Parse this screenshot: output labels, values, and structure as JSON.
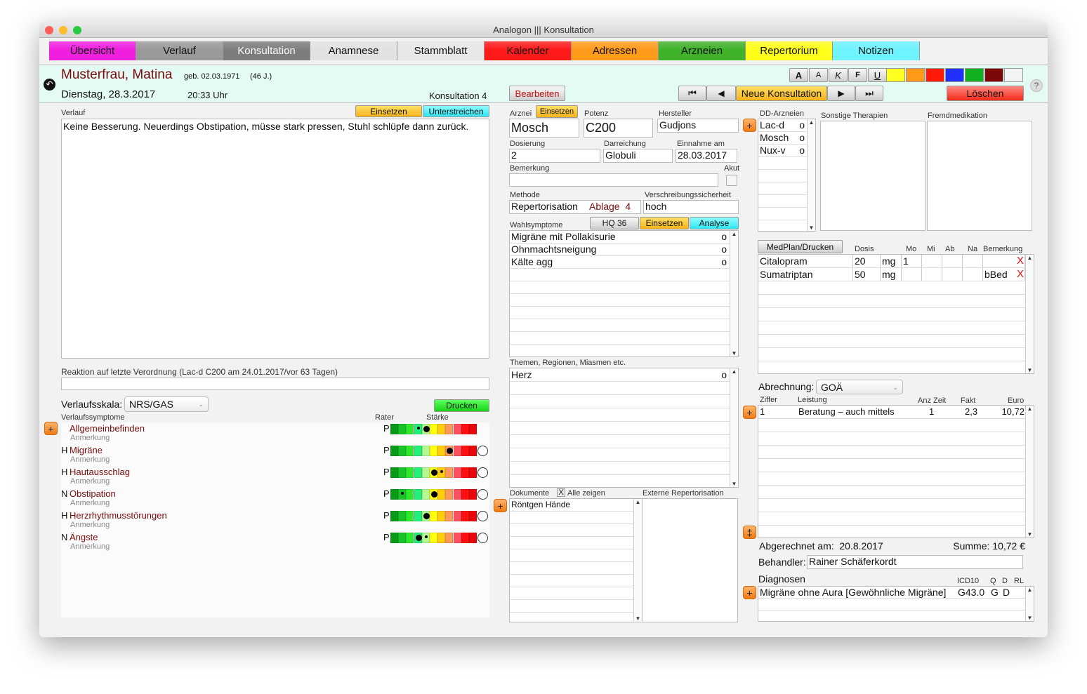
{
  "window": {
    "title": "Analogon ||| Konsultation"
  },
  "tabs": [
    {
      "label": "Übersicht",
      "color": "#f01fe0"
    },
    {
      "label": "Verlauf",
      "color": "#9a9a9a"
    },
    {
      "label": "Konsultation",
      "color": "#7d7d7d",
      "active": true
    },
    {
      "label": "Anamnese",
      "color": "#e2e2e2"
    },
    {
      "label": "Stammblatt",
      "color": "#e8e8e8"
    },
    {
      "label": "Kalender",
      "color": "#ff1a1a"
    },
    {
      "label": "Adressen",
      "color": "#ff9b1a"
    },
    {
      "label": "Arzneien",
      "color": "#3fb22a"
    },
    {
      "label": "Repertorium",
      "color": "#ffff1a"
    },
    {
      "label": "Notizen",
      "color": "#6ff3ff"
    }
  ],
  "header": {
    "patient_name": "Musterfrau, Matina",
    "birth": "geb. 02.03.1971",
    "age": "(46 J.)",
    "date": "Dienstag, 28.3.2017",
    "time": "20:33 Uhr",
    "consultation": "Konsultation 4",
    "edit": "Bearbeiten",
    "new_consultation": "Neue Konsultation",
    "delete": "Löschen",
    "help": "?",
    "format_buttons": [
      "A",
      "A",
      "K",
      "F",
      "U"
    ],
    "colors": [
      "#ffff22",
      "#ff9a1a",
      "#ff1a0a",
      "#2030ff",
      "#10b020",
      "#7a0808",
      "#f4f4f4"
    ]
  },
  "verlauf": {
    "label": "Verlauf",
    "insert": "Einsetzen",
    "underline": "Unterstreichen",
    "text": "Keine Besserung. Neuerdings Obstipation, müsse stark pressen, Stuhl schlüpfe dann zurück.",
    "reaction_label": "Reaktion auf letzte Verordnung  (Lac-d C200 am 24.01.2017/vor 63 Tagen)",
    "reaction_value": "",
    "scale_label": "Verlaufsskala:",
    "scale_value": "NRS/GAS",
    "print": "Drucken",
    "symptoms_label": "Verlaufssymptome",
    "rater_label": "Rater",
    "strength_label": "Stärke",
    "scale_colors": [
      "#0a9a1a",
      "#18c42a",
      "#2ee82e",
      "#22f07a",
      "#b6f790",
      "#ffff10",
      "#ffcc10",
      "#ff9a5a",
      "#ff5060",
      "#ff1010",
      "#e80808"
    ],
    "symptoms": [
      {
        "prefix": "",
        "name": "Allgemeinbefinden",
        "note": "Anmerkung",
        "rater": "P",
        "value": 4,
        "previous": 3,
        "circle": false
      },
      {
        "prefix": "H",
        "name": "Migräne",
        "note": "Anmerkung",
        "rater": "P",
        "value": 7,
        "previous": null,
        "circle": true
      },
      {
        "prefix": "H",
        "name": "Hautausschlag",
        "note": "Anmerkung",
        "rater": "P",
        "value": 5,
        "previous": 6,
        "circle": true
      },
      {
        "prefix": "N",
        "name": "Obstipation",
        "note": "Anmerkung",
        "rater": "P",
        "value": 5,
        "previous": 1,
        "circle": true
      },
      {
        "prefix": "H",
        "name": "Herzrhythmusstörungen",
        "note": "Anmerkung",
        "rater": "P",
        "value": 4,
        "previous": null,
        "circle": true
      },
      {
        "prefix": "N",
        "name": "Ängste",
        "note": "Anmerkung",
        "rater": "P",
        "value": 3,
        "previous": 4,
        "circle": true
      }
    ]
  },
  "remedy": {
    "arznei_label": "Arznei",
    "insert": "Einsetzen",
    "potenz_label": "Potenz",
    "hersteller_label": "Hersteller",
    "arznei": "Mosch",
    "potenz": "C200",
    "hersteller": "Gudjons",
    "dosierung_label": "Dosierung",
    "darreichung_label": "Darreichung",
    "einnahme_label": "Einnahme am",
    "dosierung": "2",
    "darreichung": "Globuli",
    "einnahme": "28.03.2017",
    "bemerkung_label": "Bemerkung",
    "bemerkung": "",
    "akut_label": "Akut",
    "akut": false,
    "methode_label": "Methode",
    "methode": "Repertorisation",
    "ablage": "Ablage  4",
    "sicherheit_label": "Verschreibungssicherheit",
    "sicherheit": "hoch",
    "wahl_label": "Wahlsymptome",
    "hq": "HQ 36",
    "wahl_insert": "Einsetzen",
    "analyse": "Analyse",
    "wahlsymptome": [
      {
        "text": "Migräne mit Pollakisurie",
        "mark": "o"
      },
      {
        "text": "Ohnmachtsneigung",
        "mark": "o"
      },
      {
        "text": "Kälte agg",
        "mark": "o"
      }
    ],
    "themen_label": "Themen, Regionen, Miasmen etc.",
    "themen": [
      {
        "text": "Herz",
        "mark": "o"
      }
    ],
    "dokumente_label": "Dokumente",
    "alle_zeigen": "Alle zeigen",
    "alle_check": "X",
    "dokumente": [
      "Röntgen Hände"
    ],
    "extern_label": "Externe Repertorisation"
  },
  "right": {
    "dd_label": "DD-Arzneien",
    "dd": [
      {
        "name": "Lac-d",
        "mark": "o"
      },
      {
        "name": "Mosch",
        "mark": "o"
      },
      {
        "name": "Nux-v",
        "mark": "o"
      }
    ],
    "sonstige_label": "Sonstige Therapien",
    "fremd_label": "Fremdmedikation",
    "medplan": "MedPlan/Drucken",
    "med_headers": {
      "dosis": "Dosis",
      "mo": "Mo",
      "mi": "Mi",
      "ab": "Ab",
      "na": "Na",
      "bem": "Bemerkung"
    },
    "meds": [
      {
        "name": "Citalopram",
        "dose": "20",
        "unit": "mg",
        "mo": "1",
        "mi": "",
        "ab": "",
        "na": "",
        "bem": "",
        "del": "X"
      },
      {
        "name": "Sumatriptan",
        "dose": "50",
        "unit": "mg",
        "mo": "",
        "mi": "",
        "ab": "",
        "na": "",
        "bem": "bBed",
        "del": "X"
      }
    ],
    "billing_label": "Abrechnung:",
    "billing_value": "GOÄ",
    "bill_headers": {
      "ziffer": "Ziffer",
      "leistung": "Leistung",
      "anz": "Anz Zeit",
      "fakt": "Fakt",
      "euro": "Euro"
    },
    "bill": [
      {
        "ziffer": "1",
        "leistung": "Beratung – auch mittels",
        "anz": "1",
        "fakt": "2,3",
        "euro": "10,72"
      }
    ],
    "abgerechnet": "Abgerechnet am:  20.8.2017",
    "summe": "Summe: 10,72 €",
    "behandler_label": "Behandler:",
    "behandler": "Rainer Schäferkordt",
    "diag_label": "Diagnosen",
    "diag_headers": {
      "icd": "ICD10",
      "q": "Q",
      "d": "D",
      "rl": "RL"
    },
    "diagnosen": [
      {
        "text": "Migräne ohne Aura [Gewöhnliche Migräne]",
        "icd": "G43.0",
        "q": "G",
        "d": "D",
        "rl": ""
      }
    ]
  }
}
